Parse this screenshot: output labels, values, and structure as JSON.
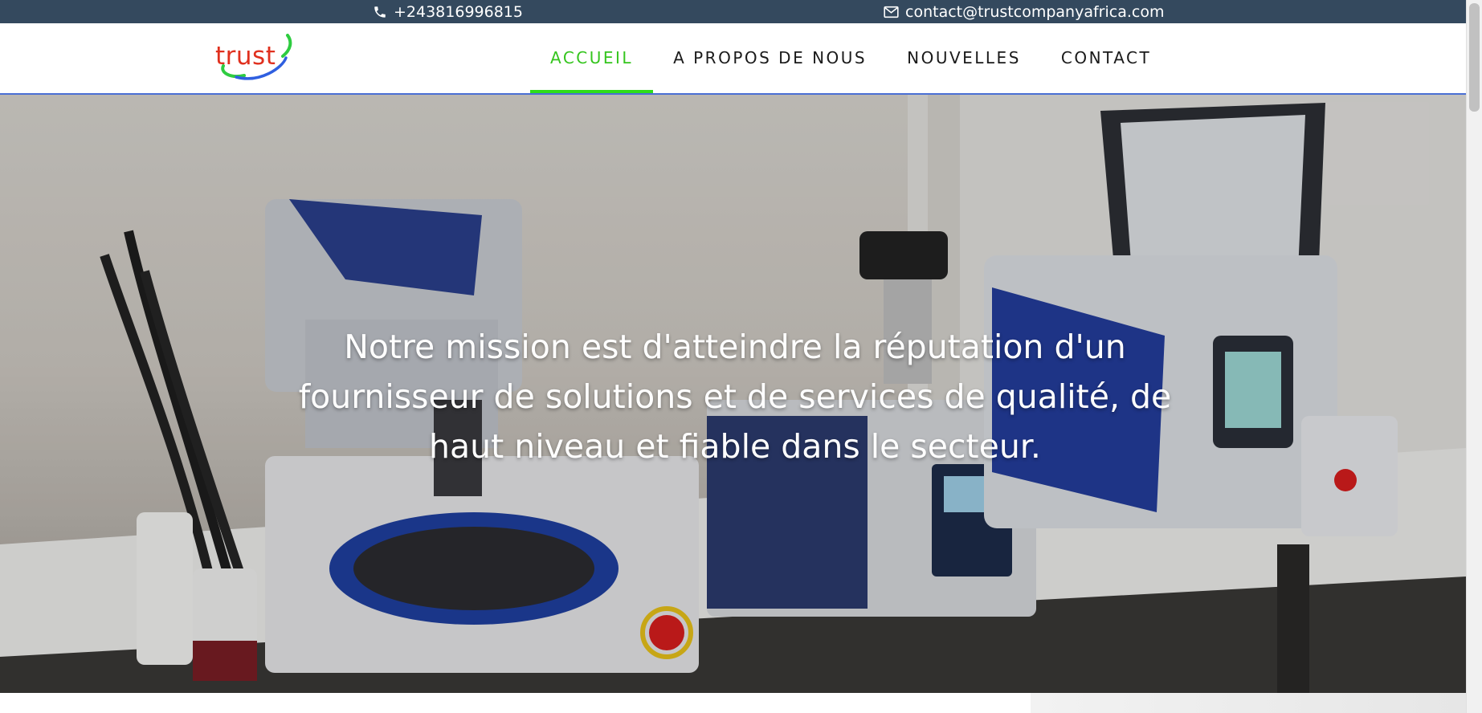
{
  "topbar": {
    "phone": "+243816996815",
    "email": "contact@trustcompanyafrica.com",
    "background": "#34495e"
  },
  "header": {
    "logo_text": "trust",
    "nav": [
      {
        "label": "ACCUEIL",
        "active": true
      },
      {
        "label": "A PROPOS DE NOUS",
        "active": false
      },
      {
        "label": "NOUVELLES",
        "active": false
      },
      {
        "label": "CONTACT",
        "active": false
      }
    ],
    "active_color": "#35c51e"
  },
  "hero": {
    "text": "Notre mission est d'atteindre la réputation d'un fournisseur de solutions et de services de qualité, de haut niveau et fiable dans le secteur."
  },
  "icons": {
    "phone": "phone-icon",
    "email": "envelope-icon",
    "logo": "trust-logo"
  }
}
